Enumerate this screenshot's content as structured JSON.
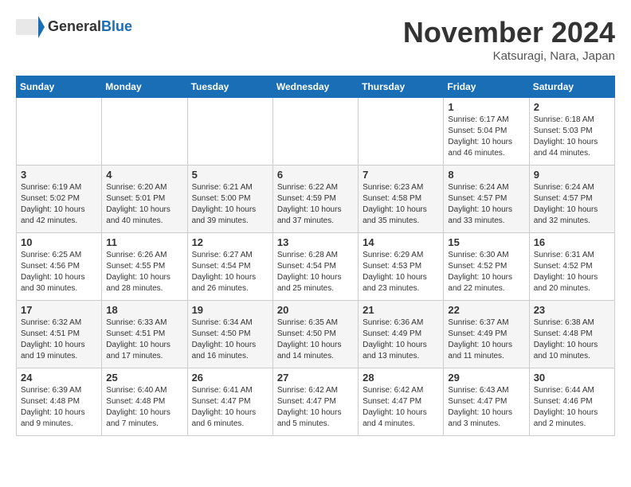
{
  "header": {
    "logo_general": "General",
    "logo_blue": "Blue",
    "month_title": "November 2024",
    "location": "Katsuragi, Nara, Japan"
  },
  "weekdays": [
    "Sunday",
    "Monday",
    "Tuesday",
    "Wednesday",
    "Thursday",
    "Friday",
    "Saturday"
  ],
  "weeks": [
    [
      {
        "day": "",
        "info": ""
      },
      {
        "day": "",
        "info": ""
      },
      {
        "day": "",
        "info": ""
      },
      {
        "day": "",
        "info": ""
      },
      {
        "day": "",
        "info": ""
      },
      {
        "day": "1",
        "info": "Sunrise: 6:17 AM\nSunset: 5:04 PM\nDaylight: 10 hours and 46 minutes."
      },
      {
        "day": "2",
        "info": "Sunrise: 6:18 AM\nSunset: 5:03 PM\nDaylight: 10 hours and 44 minutes."
      }
    ],
    [
      {
        "day": "3",
        "info": "Sunrise: 6:19 AM\nSunset: 5:02 PM\nDaylight: 10 hours and 42 minutes."
      },
      {
        "day": "4",
        "info": "Sunrise: 6:20 AM\nSunset: 5:01 PM\nDaylight: 10 hours and 40 minutes."
      },
      {
        "day": "5",
        "info": "Sunrise: 6:21 AM\nSunset: 5:00 PM\nDaylight: 10 hours and 39 minutes."
      },
      {
        "day": "6",
        "info": "Sunrise: 6:22 AM\nSunset: 4:59 PM\nDaylight: 10 hours and 37 minutes."
      },
      {
        "day": "7",
        "info": "Sunrise: 6:23 AM\nSunset: 4:58 PM\nDaylight: 10 hours and 35 minutes."
      },
      {
        "day": "8",
        "info": "Sunrise: 6:24 AM\nSunset: 4:57 PM\nDaylight: 10 hours and 33 minutes."
      },
      {
        "day": "9",
        "info": "Sunrise: 6:24 AM\nSunset: 4:57 PM\nDaylight: 10 hours and 32 minutes."
      }
    ],
    [
      {
        "day": "10",
        "info": "Sunrise: 6:25 AM\nSunset: 4:56 PM\nDaylight: 10 hours and 30 minutes."
      },
      {
        "day": "11",
        "info": "Sunrise: 6:26 AM\nSunset: 4:55 PM\nDaylight: 10 hours and 28 minutes."
      },
      {
        "day": "12",
        "info": "Sunrise: 6:27 AM\nSunset: 4:54 PM\nDaylight: 10 hours and 26 minutes."
      },
      {
        "day": "13",
        "info": "Sunrise: 6:28 AM\nSunset: 4:54 PM\nDaylight: 10 hours and 25 minutes."
      },
      {
        "day": "14",
        "info": "Sunrise: 6:29 AM\nSunset: 4:53 PM\nDaylight: 10 hours and 23 minutes."
      },
      {
        "day": "15",
        "info": "Sunrise: 6:30 AM\nSunset: 4:52 PM\nDaylight: 10 hours and 22 minutes."
      },
      {
        "day": "16",
        "info": "Sunrise: 6:31 AM\nSunset: 4:52 PM\nDaylight: 10 hours and 20 minutes."
      }
    ],
    [
      {
        "day": "17",
        "info": "Sunrise: 6:32 AM\nSunset: 4:51 PM\nDaylight: 10 hours and 19 minutes."
      },
      {
        "day": "18",
        "info": "Sunrise: 6:33 AM\nSunset: 4:51 PM\nDaylight: 10 hours and 17 minutes."
      },
      {
        "day": "19",
        "info": "Sunrise: 6:34 AM\nSunset: 4:50 PM\nDaylight: 10 hours and 16 minutes."
      },
      {
        "day": "20",
        "info": "Sunrise: 6:35 AM\nSunset: 4:50 PM\nDaylight: 10 hours and 14 minutes."
      },
      {
        "day": "21",
        "info": "Sunrise: 6:36 AM\nSunset: 4:49 PM\nDaylight: 10 hours and 13 minutes."
      },
      {
        "day": "22",
        "info": "Sunrise: 6:37 AM\nSunset: 4:49 PM\nDaylight: 10 hours and 11 minutes."
      },
      {
        "day": "23",
        "info": "Sunrise: 6:38 AM\nSunset: 4:48 PM\nDaylight: 10 hours and 10 minutes."
      }
    ],
    [
      {
        "day": "24",
        "info": "Sunrise: 6:39 AM\nSunset: 4:48 PM\nDaylight: 10 hours and 9 minutes."
      },
      {
        "day": "25",
        "info": "Sunrise: 6:40 AM\nSunset: 4:48 PM\nDaylight: 10 hours and 7 minutes."
      },
      {
        "day": "26",
        "info": "Sunrise: 6:41 AM\nSunset: 4:47 PM\nDaylight: 10 hours and 6 minutes."
      },
      {
        "day": "27",
        "info": "Sunrise: 6:42 AM\nSunset: 4:47 PM\nDaylight: 10 hours and 5 minutes."
      },
      {
        "day": "28",
        "info": "Sunrise: 6:42 AM\nSunset: 4:47 PM\nDaylight: 10 hours and 4 minutes."
      },
      {
        "day": "29",
        "info": "Sunrise: 6:43 AM\nSunset: 4:47 PM\nDaylight: 10 hours and 3 minutes."
      },
      {
        "day": "30",
        "info": "Sunrise: 6:44 AM\nSunset: 4:46 PM\nDaylight: 10 hours and 2 minutes."
      }
    ]
  ]
}
